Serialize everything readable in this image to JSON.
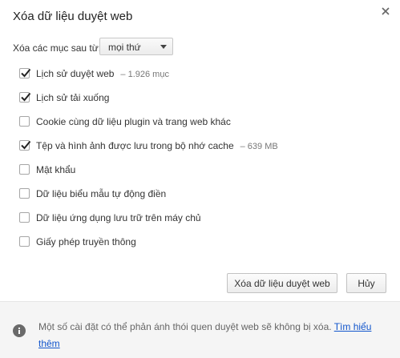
{
  "dialog": {
    "title": "Xóa dữ liệu duyệt web",
    "close_icon": "close-icon"
  },
  "clear_from": {
    "label": "Xóa các mục sau từ:",
    "selected": "mọi thứ"
  },
  "options": [
    {
      "label": "Lịch sử duyệt web",
      "detail": "– 1.926 mục",
      "checked": true
    },
    {
      "label": "Lịch sử tải xuống",
      "detail": "",
      "checked": true
    },
    {
      "label": "Cookie cùng dữ liệu plugin và trang web khác",
      "detail": "",
      "checked": false
    },
    {
      "label": "Tệp và hình ảnh được lưu trong bộ nhớ cache",
      "detail": "– 639 MB",
      "checked": true
    },
    {
      "label": "Mật khẩu",
      "detail": "",
      "checked": false
    },
    {
      "label": "Dữ liệu biểu mẫu tự động điền",
      "detail": "",
      "checked": false
    },
    {
      "label": "Dữ liệu ứng dụng lưu trữ trên máy chủ",
      "detail": "",
      "checked": false
    },
    {
      "label": "Giấy phép truyền thông",
      "detail": "",
      "checked": false
    }
  ],
  "buttons": {
    "clear": "Xóa dữ liệu duyệt web",
    "cancel": "Hủy"
  },
  "footer": {
    "text": "Một số cài đặt có thể phản ánh thói quen duyệt web sẽ không bị xóa.",
    "link": "Tìm hiểu thêm",
    "icon": "info-icon"
  },
  "colors": {
    "link": "#1155cc",
    "footer_bg": "#f5f5f5"
  }
}
